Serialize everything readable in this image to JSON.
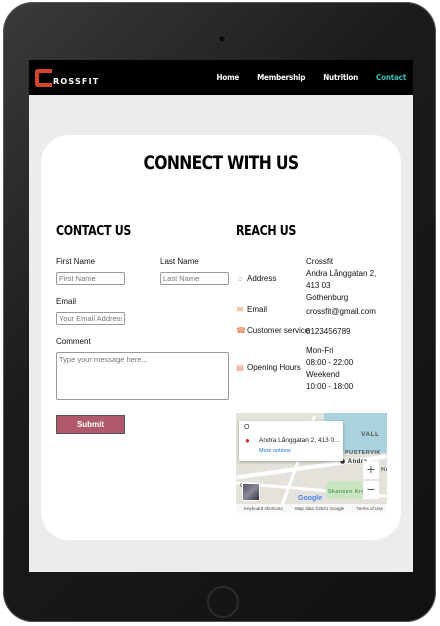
{
  "nav": {
    "logo_letter": "C",
    "logo_text": "ROSSFIT",
    "links": [
      {
        "label": "Home",
        "active": false
      },
      {
        "label": "Membership",
        "active": false
      },
      {
        "label": "Nutrition",
        "active": false
      },
      {
        "label": "Contact",
        "active": true
      }
    ]
  },
  "page": {
    "title": "CONNECT WITH US"
  },
  "contact": {
    "heading": "CONTACT US",
    "first_name_label": "First Name",
    "first_name_placeholder": "First Name",
    "last_name_label": "Last Name",
    "last_name_placeholder": "Last Name",
    "email_label": "Email",
    "email_placeholder": "Your Email Address",
    "comment_label": "Comment",
    "comment_placeholder": "Type your message here...",
    "submit_label": "Submit"
  },
  "reach": {
    "heading": "REACH US",
    "address_label": "Address",
    "address_lines": [
      "Crossfit",
      "Andra Långgatan 2,",
      "413 03",
      "Gothenburg"
    ],
    "email_label": "Email",
    "email_value": "crossfit@gmail.com",
    "phone_label": "Customer service",
    "phone_value": "0123456789",
    "hours_label": "Opening Hours",
    "hours_lines": [
      "Mon-Fri",
      "08:00 - 22:00",
      "Weekend",
      "10:00 - 18:00"
    ]
  },
  "map": {
    "search_char": "O",
    "address": "Andra Långgatan 2, 413 0...",
    "more_options": "More options",
    "place_valla": "VALL",
    "place_pusterv": "PUSTERVIK",
    "place_andra": "Andra",
    "place_ha": "HA",
    "place_skansen": "Skansen Kronan",
    "place_g": "G",
    "google": "Google",
    "footer_shortcuts": "Keyboard shortcuts",
    "footer_data": "Map data ©2021 Google",
    "footer_terms": "Terms of Use",
    "zoom_in": "+",
    "zoom_out": "−"
  },
  "icons": {
    "address": "home-icon",
    "email": "envelope-icon",
    "phone": "phone-icon",
    "hours": "book-icon"
  },
  "colors": {
    "accent": "#3fbfb5",
    "brand": "#d6462a",
    "submit": "#b0596c",
    "icon": "#e9845a"
  }
}
